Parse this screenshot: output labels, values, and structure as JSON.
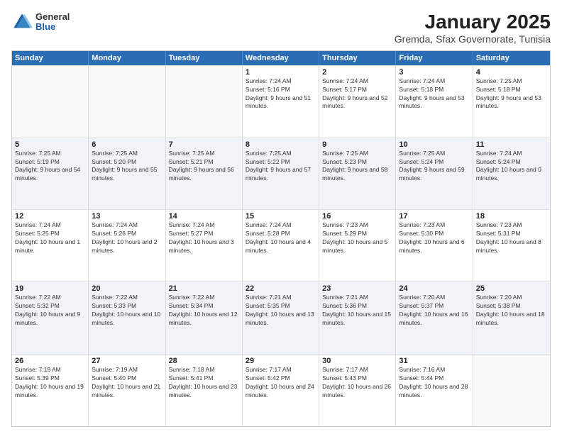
{
  "logo": {
    "general": "General",
    "blue": "Blue"
  },
  "title": "January 2025",
  "subtitle": "Gremda, Sfax Governorate, Tunisia",
  "days_of_week": [
    "Sunday",
    "Monday",
    "Tuesday",
    "Wednesday",
    "Thursday",
    "Friday",
    "Saturday"
  ],
  "weeks": [
    [
      {
        "day": "",
        "sunrise": "",
        "sunset": "",
        "daylight": "",
        "empty": true
      },
      {
        "day": "",
        "sunrise": "",
        "sunset": "",
        "daylight": "",
        "empty": true
      },
      {
        "day": "",
        "sunrise": "",
        "sunset": "",
        "daylight": "",
        "empty": true
      },
      {
        "day": "1",
        "sunrise": "Sunrise: 7:24 AM",
        "sunset": "Sunset: 5:16 PM",
        "daylight": "Daylight: 9 hours and 51 minutes.",
        "empty": false
      },
      {
        "day": "2",
        "sunrise": "Sunrise: 7:24 AM",
        "sunset": "Sunset: 5:17 PM",
        "daylight": "Daylight: 9 hours and 52 minutes.",
        "empty": false
      },
      {
        "day": "3",
        "sunrise": "Sunrise: 7:24 AM",
        "sunset": "Sunset: 5:18 PM",
        "daylight": "Daylight: 9 hours and 53 minutes.",
        "empty": false
      },
      {
        "day": "4",
        "sunrise": "Sunrise: 7:25 AM",
        "sunset": "Sunset: 5:18 PM",
        "daylight": "Daylight: 9 hours and 53 minutes.",
        "empty": false
      }
    ],
    [
      {
        "day": "5",
        "sunrise": "Sunrise: 7:25 AM",
        "sunset": "Sunset: 5:19 PM",
        "daylight": "Daylight: 9 hours and 54 minutes.",
        "empty": false
      },
      {
        "day": "6",
        "sunrise": "Sunrise: 7:25 AM",
        "sunset": "Sunset: 5:20 PM",
        "daylight": "Daylight: 9 hours and 55 minutes.",
        "empty": false
      },
      {
        "day": "7",
        "sunrise": "Sunrise: 7:25 AM",
        "sunset": "Sunset: 5:21 PM",
        "daylight": "Daylight: 9 hours and 56 minutes.",
        "empty": false
      },
      {
        "day": "8",
        "sunrise": "Sunrise: 7:25 AM",
        "sunset": "Sunset: 5:22 PM",
        "daylight": "Daylight: 9 hours and 57 minutes.",
        "empty": false
      },
      {
        "day": "9",
        "sunrise": "Sunrise: 7:25 AM",
        "sunset": "Sunset: 5:23 PM",
        "daylight": "Daylight: 9 hours and 58 minutes.",
        "empty": false
      },
      {
        "day": "10",
        "sunrise": "Sunrise: 7:25 AM",
        "sunset": "Sunset: 5:24 PM",
        "daylight": "Daylight: 9 hours and 59 minutes.",
        "empty": false
      },
      {
        "day": "11",
        "sunrise": "Sunrise: 7:24 AM",
        "sunset": "Sunset: 5:24 PM",
        "daylight": "Daylight: 10 hours and 0 minutes.",
        "empty": false
      }
    ],
    [
      {
        "day": "12",
        "sunrise": "Sunrise: 7:24 AM",
        "sunset": "Sunset: 5:25 PM",
        "daylight": "Daylight: 10 hours and 1 minute.",
        "empty": false
      },
      {
        "day": "13",
        "sunrise": "Sunrise: 7:24 AM",
        "sunset": "Sunset: 5:26 PM",
        "daylight": "Daylight: 10 hours and 2 minutes.",
        "empty": false
      },
      {
        "day": "14",
        "sunrise": "Sunrise: 7:24 AM",
        "sunset": "Sunset: 5:27 PM",
        "daylight": "Daylight: 10 hours and 3 minutes.",
        "empty": false
      },
      {
        "day": "15",
        "sunrise": "Sunrise: 7:24 AM",
        "sunset": "Sunset: 5:28 PM",
        "daylight": "Daylight: 10 hours and 4 minutes.",
        "empty": false
      },
      {
        "day": "16",
        "sunrise": "Sunrise: 7:23 AM",
        "sunset": "Sunset: 5:29 PM",
        "daylight": "Daylight: 10 hours and 5 minutes.",
        "empty": false
      },
      {
        "day": "17",
        "sunrise": "Sunrise: 7:23 AM",
        "sunset": "Sunset: 5:30 PM",
        "daylight": "Daylight: 10 hours and 6 minutes.",
        "empty": false
      },
      {
        "day": "18",
        "sunrise": "Sunrise: 7:23 AM",
        "sunset": "Sunset: 5:31 PM",
        "daylight": "Daylight: 10 hours and 8 minutes.",
        "empty": false
      }
    ],
    [
      {
        "day": "19",
        "sunrise": "Sunrise: 7:22 AM",
        "sunset": "Sunset: 5:32 PM",
        "daylight": "Daylight: 10 hours and 9 minutes.",
        "empty": false
      },
      {
        "day": "20",
        "sunrise": "Sunrise: 7:22 AM",
        "sunset": "Sunset: 5:33 PM",
        "daylight": "Daylight: 10 hours and 10 minutes.",
        "empty": false
      },
      {
        "day": "21",
        "sunrise": "Sunrise: 7:22 AM",
        "sunset": "Sunset: 5:34 PM",
        "daylight": "Daylight: 10 hours and 12 minutes.",
        "empty": false
      },
      {
        "day": "22",
        "sunrise": "Sunrise: 7:21 AM",
        "sunset": "Sunset: 5:35 PM",
        "daylight": "Daylight: 10 hours and 13 minutes.",
        "empty": false
      },
      {
        "day": "23",
        "sunrise": "Sunrise: 7:21 AM",
        "sunset": "Sunset: 5:36 PM",
        "daylight": "Daylight: 10 hours and 15 minutes.",
        "empty": false
      },
      {
        "day": "24",
        "sunrise": "Sunrise: 7:20 AM",
        "sunset": "Sunset: 5:37 PM",
        "daylight": "Daylight: 10 hours and 16 minutes.",
        "empty": false
      },
      {
        "day": "25",
        "sunrise": "Sunrise: 7:20 AM",
        "sunset": "Sunset: 5:38 PM",
        "daylight": "Daylight: 10 hours and 18 minutes.",
        "empty": false
      }
    ],
    [
      {
        "day": "26",
        "sunrise": "Sunrise: 7:19 AM",
        "sunset": "Sunset: 5:39 PM",
        "daylight": "Daylight: 10 hours and 19 minutes.",
        "empty": false
      },
      {
        "day": "27",
        "sunrise": "Sunrise: 7:19 AM",
        "sunset": "Sunset: 5:40 PM",
        "daylight": "Daylight: 10 hours and 21 minutes.",
        "empty": false
      },
      {
        "day": "28",
        "sunrise": "Sunrise: 7:18 AM",
        "sunset": "Sunset: 5:41 PM",
        "daylight": "Daylight: 10 hours and 23 minutes.",
        "empty": false
      },
      {
        "day": "29",
        "sunrise": "Sunrise: 7:17 AM",
        "sunset": "Sunset: 5:42 PM",
        "daylight": "Daylight: 10 hours and 24 minutes.",
        "empty": false
      },
      {
        "day": "30",
        "sunrise": "Sunrise: 7:17 AM",
        "sunset": "Sunset: 5:43 PM",
        "daylight": "Daylight: 10 hours and 26 minutes.",
        "empty": false
      },
      {
        "day": "31",
        "sunrise": "Sunrise: 7:16 AM",
        "sunset": "Sunset: 5:44 PM",
        "daylight": "Daylight: 10 hours and 28 minutes.",
        "empty": false
      },
      {
        "day": "",
        "sunrise": "",
        "sunset": "",
        "daylight": "",
        "empty": true
      }
    ]
  ]
}
